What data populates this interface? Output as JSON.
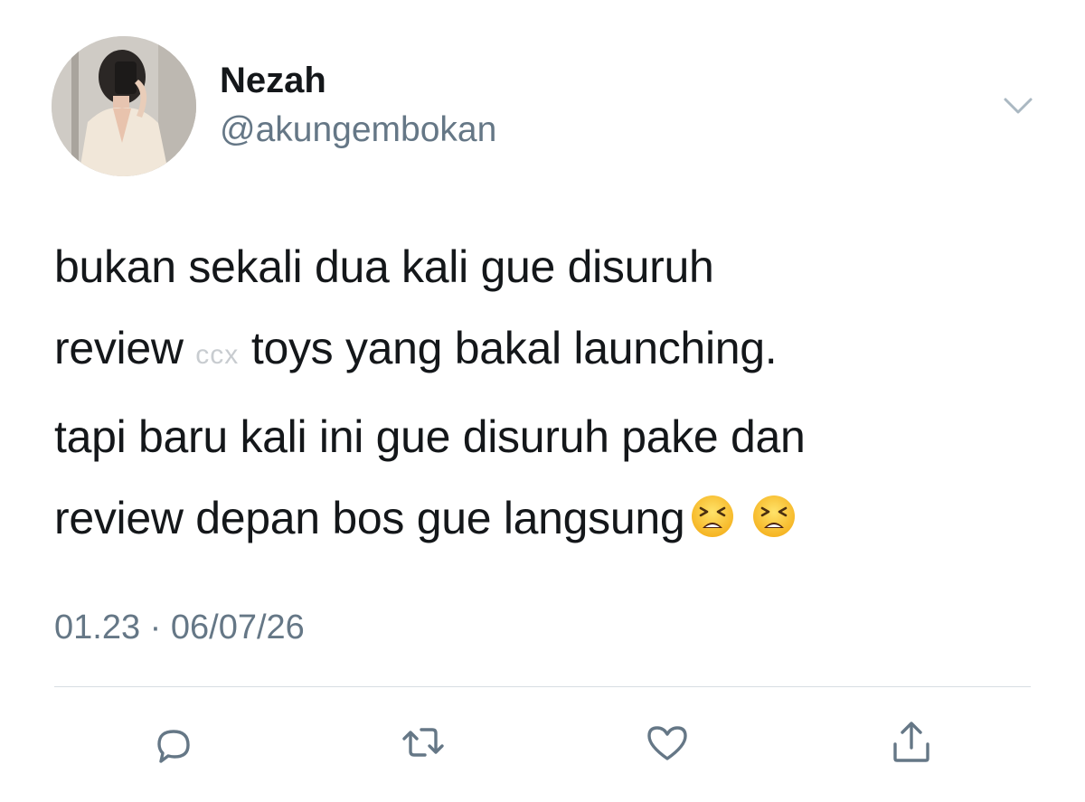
{
  "user": {
    "display_name": "Nezah",
    "handle": "@akungembokan",
    "avatar_icon": "profile-photo"
  },
  "tweet": {
    "lines": [
      "bukan sekali dua kali gue disuruh",
      "review",
      "toys yang bakal launching.",
      "tapi baru kali ini gue disuruh pake dan",
      "review depan bos gue langsung"
    ],
    "censored_word": "ccx",
    "emojis": [
      "tired-face-emoji",
      "tired-face-emoji"
    ],
    "timestamp": "01.23 · 06/07/26"
  },
  "actions": [
    {
      "name": "reply",
      "icon": "reply-icon"
    },
    {
      "name": "retweet",
      "icon": "retweet-icon"
    },
    {
      "name": "like",
      "icon": "heart-icon"
    },
    {
      "name": "share",
      "icon": "share-icon"
    }
  ],
  "colors": {
    "text": "#14171a",
    "secondary": "#657786",
    "divider": "#d8dee2",
    "icon": "#657786"
  }
}
